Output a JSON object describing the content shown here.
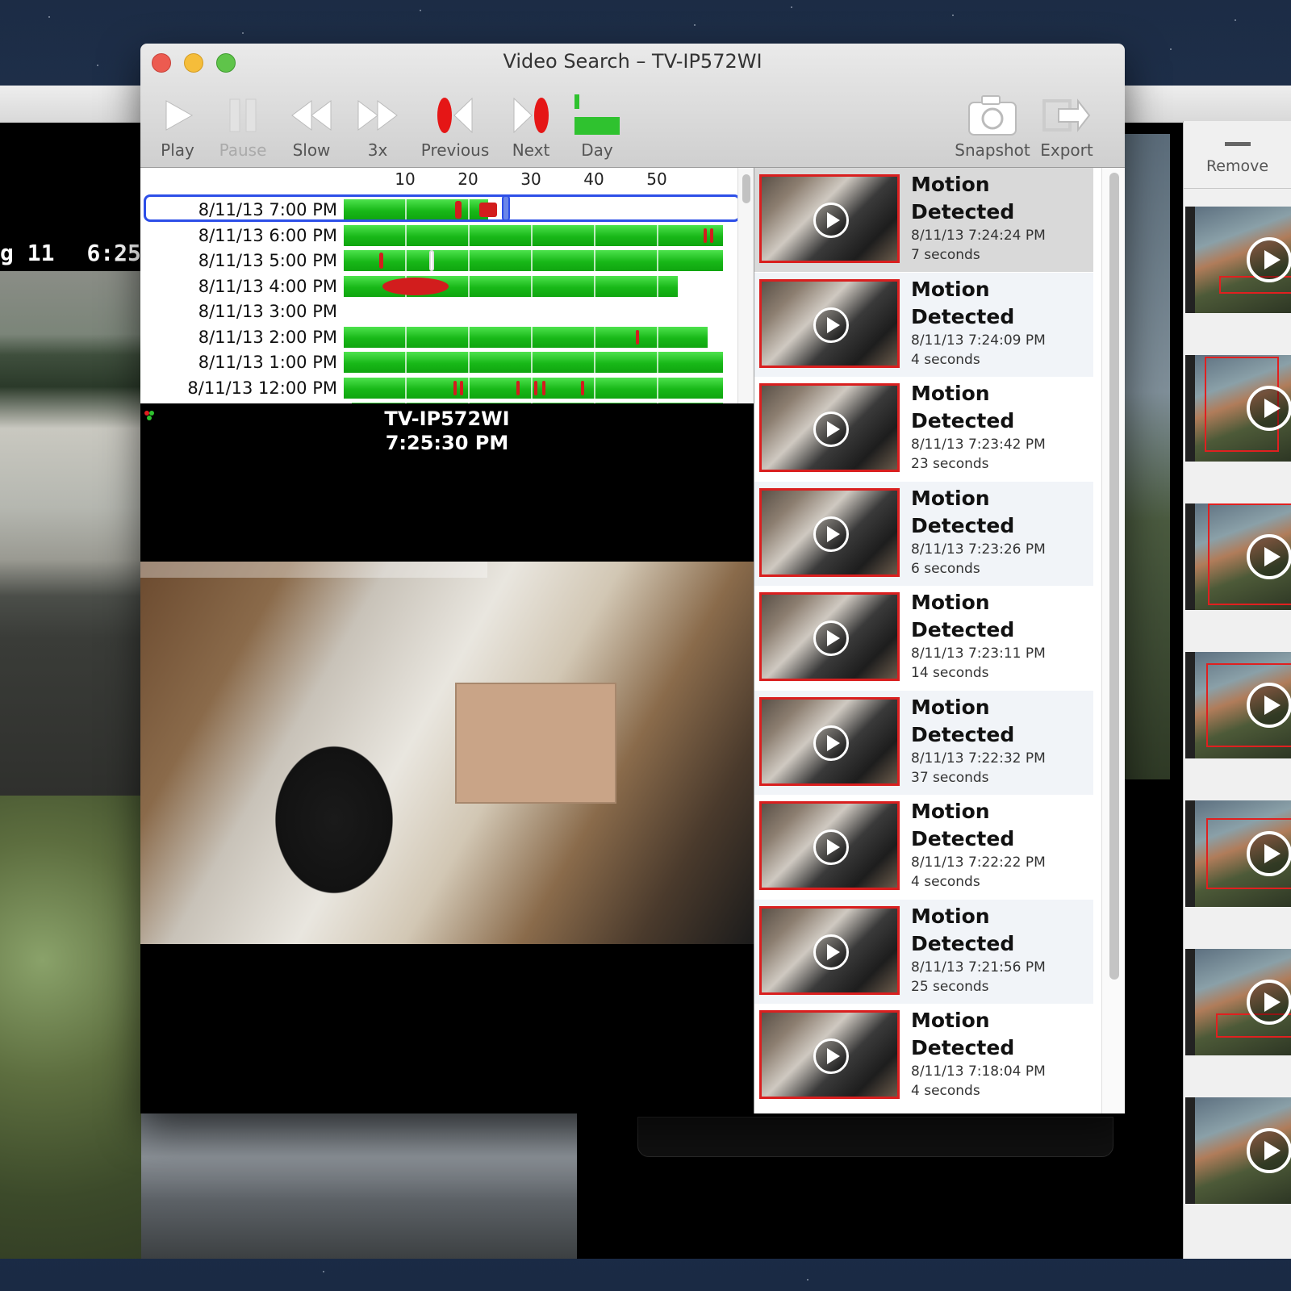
{
  "window": {
    "title": "Video Search – TV-IP572WI"
  },
  "colors": {
    "timeline_bar": "#18b818",
    "event_mark": "#d21d1d",
    "selection": "#2d4fe8",
    "thumb_border": "#d91f1f"
  },
  "toolbar": {
    "play": "Play",
    "pause": "Pause",
    "slow": "Slow",
    "fast": "3x",
    "previous": "Previous",
    "next": "Next",
    "day": "Day",
    "snapshot": "Snapshot",
    "export": "Export"
  },
  "timeline": {
    "ruler": [
      "10",
      "20",
      "30",
      "40",
      "50"
    ],
    "rows": [
      {
        "label": "8/11/13 7:00 PM",
        "fill": 0.38
      },
      {
        "label": "8/11/13 6:00 PM",
        "fill": 1.0
      },
      {
        "label": "8/11/13 5:00 PM",
        "fill": 1.0
      },
      {
        "label": "8/11/13 4:00 PM",
        "fill": 0.88
      },
      {
        "label": "8/11/13 3:00 PM",
        "fill": 0.0
      },
      {
        "label": "8/11/13 2:00 PM",
        "fill": 0.96
      },
      {
        "label": "8/11/13 1:00 PM",
        "fill": 1.0
      },
      {
        "label": "8/11/13 12:00 PM",
        "fill": 1.0
      }
    ]
  },
  "video": {
    "camera": "TV-IP572WI",
    "time": "7:25:30 PM"
  },
  "background": {
    "left_overlay_date": "g 11",
    "left_overlay_time": "6:25",
    "remove_label": "Remove"
  },
  "events": [
    {
      "title_1": "Motion",
      "title_2": "Detected",
      "datetime": "8/11/13 7:24:24 PM",
      "duration": "7 seconds"
    },
    {
      "title_1": "Motion",
      "title_2": "Detected",
      "datetime": "8/11/13 7:24:09 PM",
      "duration": "4 seconds"
    },
    {
      "title_1": "Motion",
      "title_2": "Detected",
      "datetime": "8/11/13 7:23:42 PM",
      "duration": "23 seconds"
    },
    {
      "title_1": "Motion",
      "title_2": "Detected",
      "datetime": "8/11/13 7:23:26 PM",
      "duration": "6 seconds"
    },
    {
      "title_1": "Motion",
      "title_2": "Detected",
      "datetime": "8/11/13 7:23:11 PM",
      "duration": "14 seconds"
    },
    {
      "title_1": "Motion",
      "title_2": "Detected",
      "datetime": "8/11/13 7:22:32 PM",
      "duration": "37 seconds"
    },
    {
      "title_1": "Motion",
      "title_2": "Detected",
      "datetime": "8/11/13 7:22:22 PM",
      "duration": "4 seconds"
    },
    {
      "title_1": "Motion",
      "title_2": "Detected",
      "datetime": "8/11/13 7:21:56 PM",
      "duration": "25 seconds"
    },
    {
      "title_1": "Motion",
      "title_2": "Detected",
      "datetime": "8/11/13 7:18:04 PM",
      "duration": "4 seconds"
    }
  ]
}
